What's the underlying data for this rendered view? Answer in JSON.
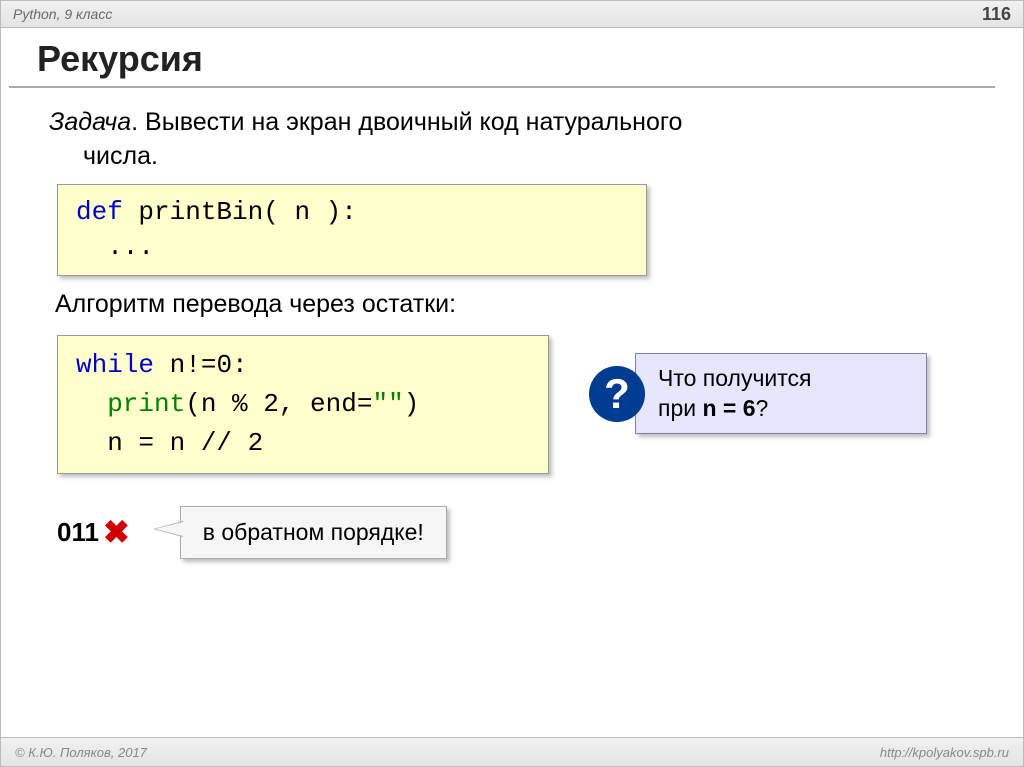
{
  "header": {
    "course": "Python, 9 класс",
    "page": "116"
  },
  "title": "Рекурсия",
  "task": {
    "lead": "Задача",
    "text_line1": ". Вывести на экран двоичный код натурального",
    "text_line2": "числа."
  },
  "code1": {
    "l1_kw": "def",
    "l1_rest": " printBin( n ):",
    "l2": "  ..."
  },
  "subhead": "Алгоритм перевода через остатки:",
  "code2": {
    "l1_kw": "while",
    "l1_rest": " n!=",
    "l1_zero": "0",
    "l1_colon": ":",
    "l2_print": "  print",
    "l2_open": "(n % ",
    "l2_two": "2",
    "l2_end": ", end=",
    "l2_str": "\"\"",
    "l2_close": ")",
    "l3_a": "  n = n // ",
    "l3_two": "2"
  },
  "question": {
    "mark": "?",
    "line1": "Что получится",
    "line2_a": "при ",
    "line2_b": "n = 6",
    "line2_c": "?"
  },
  "result": {
    "value": "011",
    "cross": "✖"
  },
  "callout": "в обратном порядке!",
  "footer": {
    "copyright": "© К.Ю. Поляков, 2017",
    "url": "http://kpolyakov.spb.ru"
  }
}
